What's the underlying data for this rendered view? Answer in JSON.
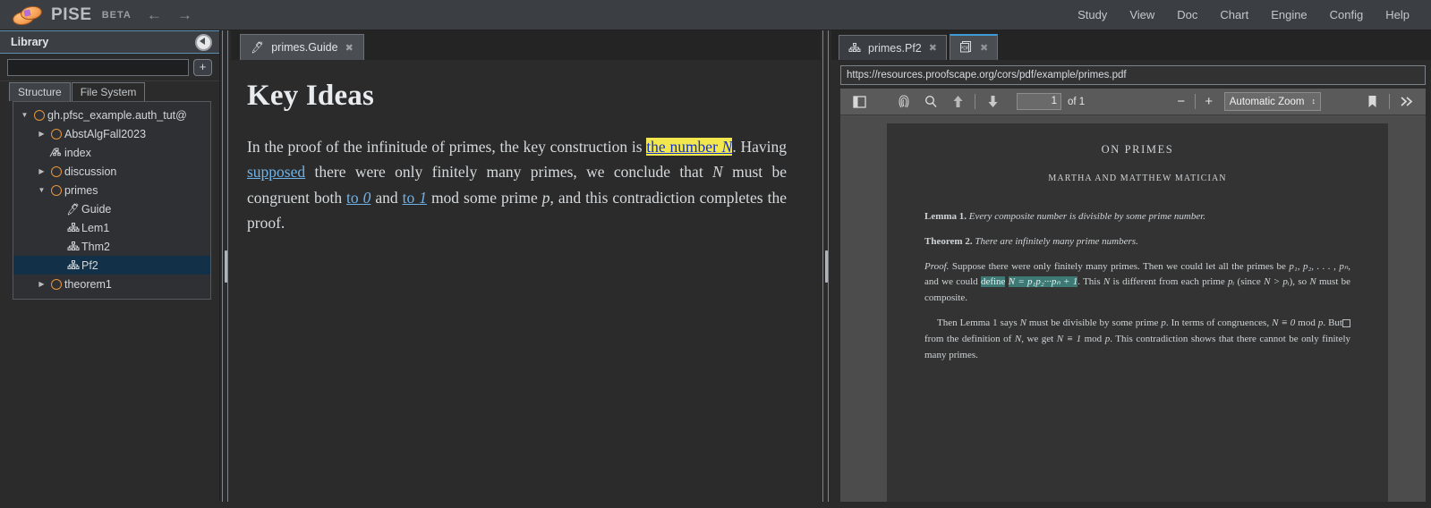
{
  "header": {
    "brand": "PISE",
    "beta": "BETA",
    "back_arrow": "←",
    "forward_arrow": "→",
    "menu": [
      "Study",
      "View",
      "Doc",
      "Chart",
      "Engine",
      "Config",
      "Help"
    ]
  },
  "sidebar": {
    "title": "Library",
    "search_value": "",
    "search_placeholder": "",
    "add_label": "+",
    "tabs": [
      {
        "label": "Structure",
        "active": true
      },
      {
        "label": "File System",
        "active": false
      }
    ],
    "tree": [
      {
        "label": "gh.pfsc_example.auth_tut@",
        "icon": "repo",
        "caret": "▼",
        "depth": 0,
        "selected": false
      },
      {
        "label": "AbstAlgFall2023",
        "icon": "repo",
        "caret": "▶",
        "depth": 1,
        "selected": false
      },
      {
        "label": "index",
        "icon": "index",
        "caret": "",
        "depth": 1,
        "selected": false
      },
      {
        "label": "discussion",
        "icon": "repo",
        "caret": "▶",
        "depth": 1,
        "selected": false
      },
      {
        "label": "primes",
        "icon": "repo",
        "caret": "▼",
        "depth": 1,
        "selected": false
      },
      {
        "label": "Guide",
        "icon": "quill",
        "caret": "",
        "depth": 2,
        "selected": false
      },
      {
        "label": "Lem1",
        "icon": "tree",
        "caret": "",
        "depth": 2,
        "selected": false
      },
      {
        "label": "Thm2",
        "icon": "tree",
        "caret": "",
        "depth": 2,
        "selected": false
      },
      {
        "label": "Pf2",
        "icon": "tree",
        "caret": "",
        "depth": 2,
        "selected": true
      },
      {
        "label": "theorem1",
        "icon": "repo",
        "caret": "▶",
        "depth": 1,
        "selected": false
      }
    ]
  },
  "center": {
    "tab": {
      "label": "primes.Guide",
      "close": "✖",
      "icon": "quill-icon"
    },
    "doc": {
      "title": "Key Ideas",
      "text_1": "In the proof of the infinitude of primes, the key construction is ",
      "link_number_n_a": "the number ",
      "link_number_n_b": "N",
      "text_2": ". Having ",
      "link_supposed": "supposed",
      "text_3": " there were only finitely many primes, we conclude that ",
      "var_n": "N",
      "text_4": " must be congruent both ",
      "link_to_0_a": "to ",
      "link_to_0_b": "0",
      "text_5": " and ",
      "link_to_1_a": "to ",
      "link_to_1_b": "1",
      "text_6": " mod some prime ",
      "var_p": "p",
      "text_7": ", and this contradiction completes the proof."
    }
  },
  "right": {
    "tabs": [
      {
        "label": "primes.Pf2",
        "close": "✖",
        "icon": "tree-icon",
        "active": false
      },
      {
        "label": "",
        "close": "✖",
        "icon": "pdf-icon",
        "active": true
      }
    ],
    "pdf": {
      "url": "https://resources.proofscape.org/cors/pdf/example/primes.pdf",
      "page_value": "1",
      "page_total": "of 1",
      "zoom_out": "−",
      "zoom_in": "+",
      "zoom_level": "Automatic Zoom",
      "toolbar_icons": [
        "sidebar-toggle-icon",
        "thumbnail-icon",
        "search-icon",
        "page-up-icon",
        "page-down-icon",
        "bookmark-icon",
        "more-tools-icon"
      ],
      "document": {
        "title": "ON PRIMES",
        "authors": "MARTHA AND MATTHEW MATICIAN",
        "lemma_label": "Lemma 1.",
        "lemma_text": "Every composite number is divisible by some prime number.",
        "theorem_label": "Theorem 2.",
        "theorem_text": "There are infinitely many prime numbers.",
        "proof_label": "Proof.",
        "proof_p1_a": " Suppose there were only finitely many primes. Then we could let all the primes be ",
        "proof_p1_primes": "p₁, p₂, . . . , pₙ",
        "proof_p1_b": ", and we could ",
        "proof_hl_define": "define",
        "proof_hl_formula": "N = p₁p₂···pₙ + 1",
        "proof_p1_c": ". This ",
        "proof_p1_n": "N",
        "proof_p1_d": " is different from each prime ",
        "proof_p1_pi": "pᵢ",
        "proof_p1_e": " (since ",
        "proof_p1_ineq": "N > pᵢ",
        "proof_p1_f": "), so ",
        "proof_p1_n2": "N",
        "proof_p1_g": " must be composite.",
        "proof_p2_a": "Then Lemma 1 says ",
        "proof_p2_n": "N",
        "proof_p2_b": " must be divisible by some prime ",
        "proof_p2_p": "p",
        "proof_p2_c": ". In terms of congruences, ",
        "proof_p2_cong0": "N ≡ 0",
        "proof_p2_mod": " mod ",
        "proof_p2_p2": "p",
        "proof_p2_d": ". But from the definition of ",
        "proof_p2_n2": "N",
        "proof_p2_e": ", we get ",
        "proof_p2_cong1": "N ≡ 1",
        "proof_p2_mod2": " mod ",
        "proof_p2_p3": "p",
        "proof_p2_f": ". This contradiction shows that there cannot be only finitely many primes."
      }
    }
  },
  "colors": {
    "accent_blue": "#3d9bd8",
    "highlight_yellow": "#f2e84e",
    "highlight_teal": "#3d7a75",
    "repo_orange": "#e8963c",
    "selection_navy": "#123047"
  }
}
